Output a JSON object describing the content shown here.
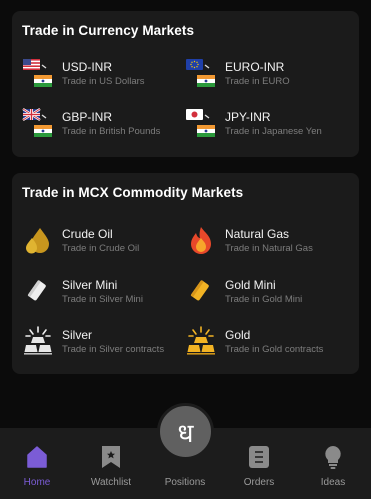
{
  "currency": {
    "title": "Trade in Currency Markets",
    "items": [
      {
        "name": "USD-INR",
        "sub": "Trade in US Dollars"
      },
      {
        "name": "EURO-INR",
        "sub": "Trade in EURO"
      },
      {
        "name": "GBP-INR",
        "sub": "Trade in British Pounds"
      },
      {
        "name": "JPY-INR",
        "sub": "Trade in Japanese Yen"
      }
    ]
  },
  "mcx": {
    "title": "Trade in MCX Commodity Markets",
    "items": [
      {
        "name": "Crude Oil",
        "sub": "Trade in Crude Oil"
      },
      {
        "name": "Natural Gas",
        "sub": "Trade in Natural Gas"
      },
      {
        "name": "Silver Mini",
        "sub": "Trade in Silver Mini"
      },
      {
        "name": "Gold Mini",
        "sub": "Trade in Gold Mini"
      },
      {
        "name": "Silver",
        "sub": "Trade in Silver contracts"
      },
      {
        "name": "Gold",
        "sub": "Trade in Gold contracts"
      }
    ]
  },
  "nav": {
    "items": [
      {
        "label": "Home",
        "icon": "home-icon"
      },
      {
        "label": "Watchlist",
        "icon": "bookmark-icon"
      },
      {
        "label": "Positions",
        "icon": "positions-icon"
      },
      {
        "label": "Orders",
        "icon": "orders-icon"
      },
      {
        "label": "Ideas",
        "icon": "bulb-icon"
      }
    ],
    "fab_glyph": "ध",
    "active_color": "#7b5cd6"
  }
}
